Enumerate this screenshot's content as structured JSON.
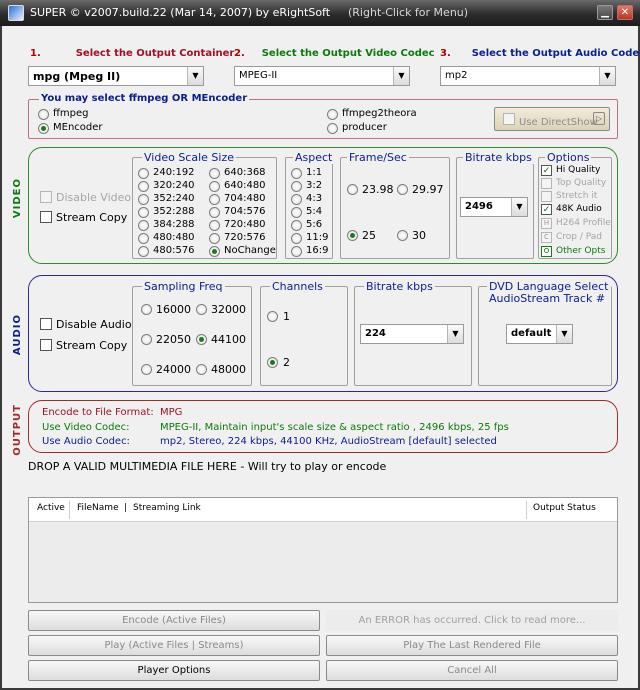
{
  "window": {
    "title": "SUPER © v2007.build.22 (Mar 14, 2007) by eRightSoft",
    "hint": "(Right-Click for Menu)",
    "minimize": "▁",
    "close": "✕"
  },
  "steps": [
    {
      "num": "1.",
      "label": "Select the Output Container",
      "color": "#a0102a",
      "value": "mpg  (Mpeg II)"
    },
    {
      "num": "2.",
      "label": "Select the Output Video Codec",
      "color": "#0a7a0a",
      "value": "MPEG-II"
    },
    {
      "num": "3.",
      "label": "Select the Output Audio Codec",
      "color": "#0a1e8c",
      "value": "mp2"
    }
  ],
  "encoder": {
    "title": "You may select ffmpeg OR MEncoder",
    "options": [
      "ffmpeg",
      "MEncoder",
      "ffmpeg2theora",
      "producer"
    ],
    "selected": "MEncoder",
    "directshow_label": "Use DirectShow"
  },
  "video": {
    "section_label": "VIDEO",
    "disable_label": "Disable Video",
    "stream_copy_label": "Stream Copy",
    "scale_title": "Video Scale Size",
    "scale_left": [
      "240:192",
      "320:240",
      "352:240",
      "352:288",
      "384:288",
      "480:480",
      "480:576"
    ],
    "scale_right": [
      "640:368",
      "640:480",
      "704:480",
      "704:576",
      "720:480",
      "720:576",
      "NoChange"
    ],
    "scale_selected": "NoChange",
    "aspect_title": "Aspect",
    "aspects": [
      "1:1",
      "3:2",
      "4:3",
      "5:4",
      "5:6",
      "11:9",
      "16:9"
    ],
    "framerate_title": "Frame/Sec",
    "framerates": [
      "23.98",
      "29.97",
      "25",
      "30"
    ],
    "framerate_selected": "25",
    "bitrate_title": "Bitrate  kbps",
    "bitrate": "2496",
    "options_title": "Options",
    "options": [
      {
        "label": "Hi Quality",
        "checked": true,
        "enabled": true
      },
      {
        "label": "Top Quality",
        "checked": false,
        "enabled": false
      },
      {
        "label": "Stretch it",
        "checked": false,
        "enabled": false
      },
      {
        "label": "48K Audio",
        "checked": true,
        "enabled": true
      },
      {
        "label": "H264 Profile",
        "checked": false,
        "enabled": false
      },
      {
        "label": "Crop / Pad",
        "checked": false,
        "enabled": false
      },
      {
        "label": "Other Opts",
        "checked": false,
        "enabled": true
      }
    ],
    "option_icons": {
      "h264": "H",
      "crop": "C",
      "other": "O"
    }
  },
  "audio": {
    "section_label": "AUDIO",
    "disable_label": "Disable Audio",
    "stream_copy_label": "Stream Copy",
    "sampling_title": "Sampling Freq",
    "sampling": [
      "16000",
      "32000",
      "22050",
      "44100",
      "24000",
      "48000"
    ],
    "sampling_selected": "44100",
    "channels_title": "Channels",
    "channels": [
      "1",
      "2"
    ],
    "channels_selected": "2",
    "bitrate_title": "Bitrate  kbps",
    "bitrate": "224",
    "dvd_title_1": "DVD Language Select",
    "dvd_title_2": "AudioStream  Track #",
    "dvd_value": "default"
  },
  "output": {
    "section_label": "OUTPUT",
    "rows": [
      {
        "label": "Encode to File Format:",
        "value": "MPG",
        "label_color": "#a0102a",
        "value_color": "#a0102a"
      },
      {
        "label": "Use Video Codec:",
        "value": "MPEG-II,  Maintain input's scale size & aspect ratio ,  2496 kbps,  25 fps",
        "label_color": "#0a7a0a",
        "value_color": "#0a7a0a"
      },
      {
        "label": "Use Audio Codec:",
        "value": "mp2,  Stereo,  224 kbps,  44100 KHz,  AudioStream [default] selected",
        "label_color": "#0a1e8c",
        "value_color": "#0a1e8c"
      }
    ]
  },
  "drop_text": "DROP A VALID MULTIMEDIA FILE HERE - Will try to play or encode",
  "table": {
    "columns": [
      "Active",
      "FileName",
      "|",
      "Streaming Link",
      "Output Status"
    ]
  },
  "buttons": {
    "encode": "Encode (Active Files)",
    "error": "An ERROR has occurred. Click to read more...",
    "play_active": "Play (Active Files | Streams)",
    "play_last": "Play The Last Rendered File",
    "player_options": "Player Options",
    "cancel_all": "Cancel All"
  },
  "colors": {
    "container_red": "#a0102a",
    "video_green": "#2e8b2e",
    "audio_blue": "#2b2b8a",
    "output_red": "#a22a2a"
  }
}
